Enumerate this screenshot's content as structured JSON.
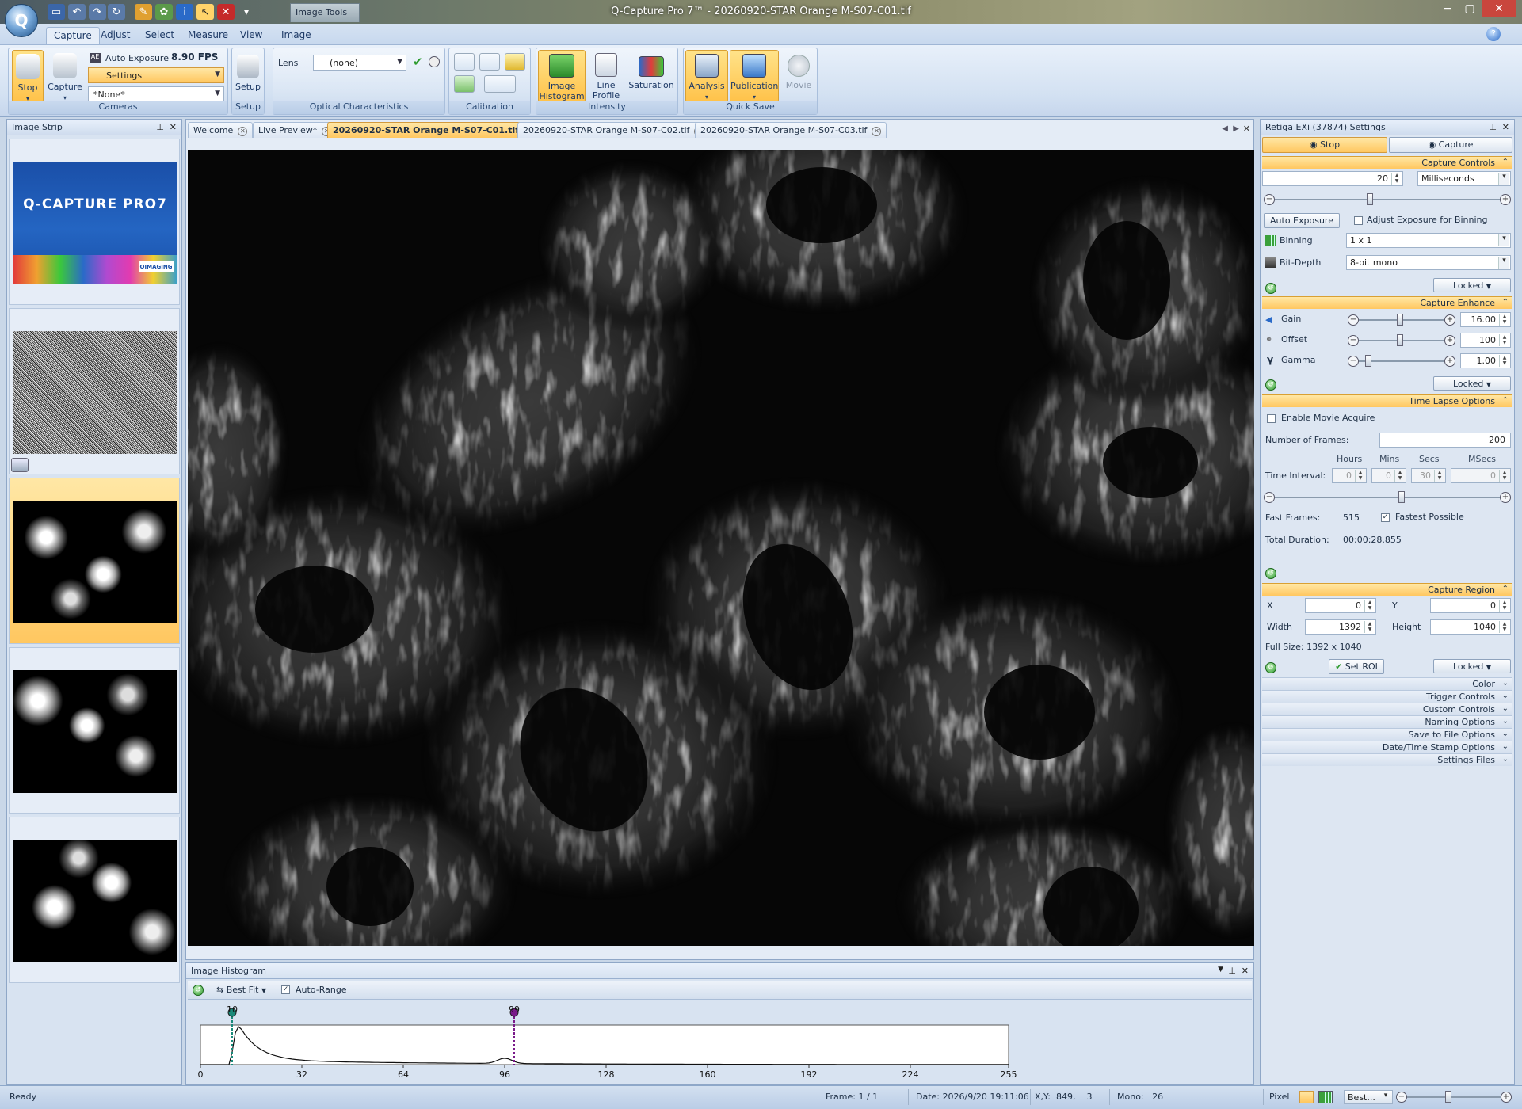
{
  "window": {
    "title": "Q-Capture Pro 7™ - 20260920-STAR Orange M-S07-C01.tif",
    "contextual_tab": "Image Tools"
  },
  "ribbon": {
    "tabs": [
      "Capture",
      "Adjust",
      "Select",
      "Measure",
      "View",
      "Image"
    ],
    "active_tab": "Capture",
    "cameras": {
      "stop_label": "Stop",
      "capture_label": "Capture",
      "auto_exposure_label": "Auto Exposure",
      "fps": "8.90 FPS",
      "settings_value": "Settings",
      "preset_value": "*None*",
      "group_label": "Cameras"
    },
    "setup": {
      "button_label": "Setup",
      "group_label": "Setup"
    },
    "optical": {
      "lens_label": "Lens",
      "lens_value": "(none)",
      "group_label": "Optical Characteristics"
    },
    "calibration": {
      "group_label": "Calibration"
    },
    "intensity": {
      "image_histogram_label": "Image Histogram",
      "line_profile_label": "Line Profile",
      "saturation_label": "Saturation",
      "group_label": "Intensity"
    },
    "quicksave": {
      "analysis_label": "Analysis",
      "publication_label": "Publication",
      "movie_label": "Movie",
      "group_label": "Quick Save"
    }
  },
  "image_strip": {
    "title": "Image Strip",
    "splash_text": "Q-CAPTURE PRO7",
    "splash_brand": "QIMAGING"
  },
  "doc_tabs": [
    {
      "label": "Welcome",
      "active": false
    },
    {
      "label": "Live Preview*",
      "active": false
    },
    {
      "label": "20260920-STAR Orange M-S07-C01.tif",
      "active": true
    },
    {
      "label": "20260920-STAR Orange M-S07-C02.tif",
      "active": false
    },
    {
      "label": "20260920-STAR Orange M-S07-C03.tif",
      "active": false
    }
  ],
  "histogram": {
    "title": "Image Histogram",
    "fit_label": "Best Fit",
    "auto_range_label": "Auto-Range",
    "auto_range_checked": true,
    "black_marker": "10",
    "white_marker": "99",
    "axis_ticks": [
      "0",
      "32",
      "64",
      "96",
      "128",
      "160",
      "192",
      "224",
      "255"
    ],
    "colors": {
      "black_marker": "#1a8a7a",
      "white_marker": "#7a1a8a"
    }
  },
  "settings": {
    "title": "Retiga EXi (37874) Settings",
    "stop_label": "Stop",
    "capture_label": "Capture",
    "capture_controls": {
      "header": "Capture Controls",
      "exposure_value": "20",
      "exposure_unit": "Milliseconds",
      "auto_exposure_button": "Auto Exposure",
      "adjust_binning_label": "Adjust Exposure for Binning",
      "binning_label": "Binning",
      "binning_value": "1 x 1",
      "bitdepth_label": "Bit-Depth",
      "bitdepth_value": "8-bit mono",
      "lock_value": "Locked"
    },
    "capture_enhance": {
      "header": "Capture Enhance",
      "gain_label": "Gain",
      "gain_value": "16.00",
      "offset_label": "Offset",
      "offset_value": "100",
      "gamma_label": "Gamma",
      "gamma_value": "1.00",
      "lock_value": "Locked"
    },
    "time_lapse": {
      "header": "Time Lapse Options",
      "enable_label": "Enable Movie Acquire",
      "frames_label": "Number of Frames:",
      "frames_value": "200",
      "col_hours": "Hours",
      "col_mins": "Mins",
      "col_secs": "Secs",
      "col_msecs": "MSecs",
      "interval_label": "Time Interval:",
      "hours": "0",
      "mins": "0",
      "secs": "30",
      "msecs": "0",
      "fast_frames_label": "Fast Frames:",
      "fast_frames_value": "515",
      "fastest_label": "Fastest Possible",
      "total_duration_label": "Total Duration:",
      "total_duration_value": "00:00:28.855"
    },
    "capture_region": {
      "header": "Capture Region",
      "x_label": "X",
      "x_value": "0",
      "y_label": "Y",
      "y_value": "0",
      "width_label": "Width",
      "width_value": "1392",
      "height_label": "Height",
      "height_value": "1040",
      "full_size": "Full Size: 1392 x 1040",
      "set_roi_label": "Set ROI",
      "lock_value": "Locked"
    },
    "collapsed_sections": [
      "Color",
      "Trigger Controls",
      "Custom Controls",
      "Naming Options",
      "Save to File Options",
      "Date/Time Stamp Options",
      "Settings Files"
    ]
  },
  "status_bar": {
    "ready": "Ready",
    "frame": "Frame: 1 / 1",
    "date": "Date: 2026/9/20 19:11:06",
    "xy": "X,Y:  849,    3",
    "mono": "Mono:   26",
    "unit": "Pixel",
    "zoom": "Best..."
  }
}
